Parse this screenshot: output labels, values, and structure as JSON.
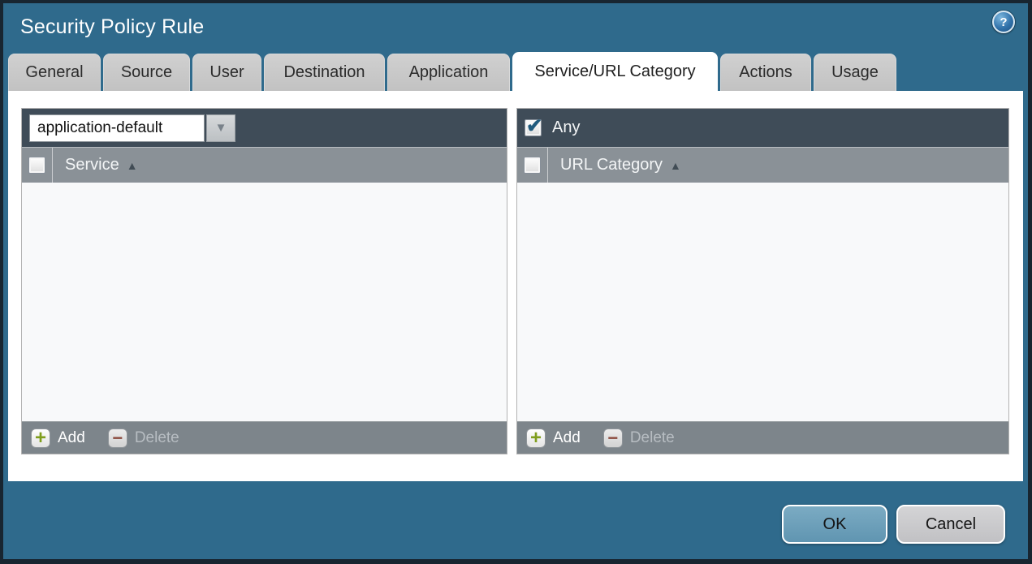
{
  "dialog": {
    "title": "Security Policy Rule"
  },
  "icons": {
    "help_glyph": "?",
    "dropdown_arrow": "▼",
    "sort_asc": "▲",
    "add_plus": "+",
    "delete_minus": "−",
    "check": "✔"
  },
  "tabs": [
    {
      "label": "General",
      "active": false
    },
    {
      "label": "Source",
      "active": false
    },
    {
      "label": "User",
      "active": false
    },
    {
      "label": "Destination",
      "active": false
    },
    {
      "label": "Application",
      "active": false
    },
    {
      "label": "Service/URL Category",
      "active": true
    },
    {
      "label": "Actions",
      "active": false
    },
    {
      "label": "Usage",
      "active": false
    }
  ],
  "service_panel": {
    "dropdown_value": "application-default",
    "column_header": "Service",
    "rows": [],
    "add_label": "Add",
    "delete_label": "Delete",
    "delete_enabled": false
  },
  "url_category_panel": {
    "any_label": "Any",
    "any_checked": true,
    "column_header": "URL Category",
    "rows": [],
    "add_label": "Add",
    "delete_label": "Delete",
    "delete_enabled": false
  },
  "footer": {
    "ok_label": "OK",
    "cancel_label": "Cancel"
  },
  "colors": {
    "window_background": "#2f6a8c",
    "window_border": "#182530",
    "toolbar_dark": "#3f4c58",
    "header_gray": "#8a9197",
    "footer_bar_gray": "#7d858b",
    "tab_inactive": "#c6c6c6",
    "tab_active": "#ffffff",
    "ok_button": "#6ba3bd",
    "cancel_button": "#c9c9cb",
    "add_plus_green": "#7f9e1d",
    "delete_minus_red": "#8c4a3e",
    "checkmark_blue": "#1f5a7d"
  }
}
